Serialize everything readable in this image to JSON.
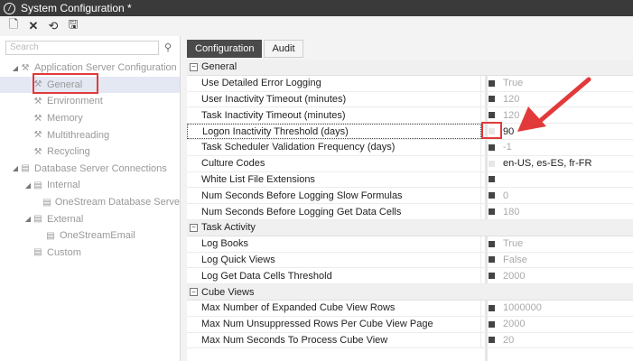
{
  "window": {
    "title": "System Configuration *"
  },
  "toolbar": {
    "buttons": [
      {
        "name": "new-button",
        "icon": "new-document-icon"
      },
      {
        "name": "delete-button",
        "icon": "close-icon"
      },
      {
        "name": "refresh-button",
        "icon": "refresh-icon"
      },
      {
        "name": "save-button",
        "icon": "save-icon"
      }
    ]
  },
  "search": {
    "placeholder": "Search"
  },
  "tree": [
    {
      "label": "Application Server Configuration",
      "depth": 0,
      "twisty": "◢",
      "icon": "wrench-icon"
    },
    {
      "label": "General",
      "depth": 1,
      "twisty": "",
      "icon": "wrench-icon",
      "selected": true
    },
    {
      "label": "Environment",
      "depth": 1,
      "twisty": "",
      "icon": "wrench-icon"
    },
    {
      "label": "Memory",
      "depth": 1,
      "twisty": "",
      "icon": "wrench-icon"
    },
    {
      "label": "Multithreading",
      "depth": 1,
      "twisty": "",
      "icon": "wrench-icon"
    },
    {
      "label": "Recycling",
      "depth": 1,
      "twisty": "",
      "icon": "wrench-icon"
    },
    {
      "label": "Database Server Connections",
      "depth": 0,
      "twisty": "◢",
      "icon": "database-icon"
    },
    {
      "label": "Internal",
      "depth": 1,
      "twisty": "◢",
      "icon": "database-icon"
    },
    {
      "label": "OneStream Database Serve",
      "depth": 2,
      "twisty": "",
      "icon": "database-icon"
    },
    {
      "label": "External",
      "depth": 1,
      "twisty": "◢",
      "icon": "database-icon"
    },
    {
      "label": "OneStreamEmail",
      "depth": 2,
      "twisty": "",
      "icon": "database-icon"
    },
    {
      "label": "Custom",
      "depth": 1,
      "twisty": "",
      "icon": "database-icon"
    }
  ],
  "tabs": [
    {
      "label": "Configuration",
      "active": true
    },
    {
      "label": "Audit",
      "active": false
    }
  ],
  "grid": [
    {
      "type": "category",
      "label": "General",
      "toggle": "⊟"
    },
    {
      "type": "prop",
      "name": "Use Detailed Error Logging",
      "value": "True",
      "check": "on"
    },
    {
      "type": "prop",
      "name": "User Inactivity Timeout (minutes)",
      "value": "120",
      "check": "on"
    },
    {
      "type": "prop",
      "name": "Task Inactivity Timeout (minutes)",
      "value": "120",
      "check": "on"
    },
    {
      "type": "prop",
      "name": "Logon Inactivity Threshold (days)",
      "value": "90",
      "check": "off",
      "focused": true,
      "dark": true
    },
    {
      "type": "prop",
      "name": "Task Scheduler Validation Frequency (days)",
      "value": "-1",
      "check": "on"
    },
    {
      "type": "prop",
      "name": "Culture Codes",
      "value": "en-US, es-ES, fr-FR",
      "check": "off",
      "dark": true
    },
    {
      "type": "prop",
      "name": "White List File Extensions",
      "value": "",
      "check": "on"
    },
    {
      "type": "prop",
      "name": "Num Seconds Before Logging Slow Formulas",
      "value": "0",
      "check": "on"
    },
    {
      "type": "prop",
      "name": "Num Seconds Before Logging Get Data Cells",
      "value": "180",
      "check": "on"
    },
    {
      "type": "category",
      "label": "Task Activity",
      "toggle": "⊟"
    },
    {
      "type": "prop",
      "name": "Log Books",
      "value": "True",
      "check": "on"
    },
    {
      "type": "prop",
      "name": "Log Quick Views",
      "value": "False",
      "check": "on"
    },
    {
      "type": "prop",
      "name": "Log Get Data Cells Threshold",
      "value": "2000",
      "check": "on"
    },
    {
      "type": "category",
      "label": "Cube Views",
      "toggle": "⊟"
    },
    {
      "type": "prop",
      "name": "Max Number of Expanded Cube View Rows",
      "value": "1000000",
      "check": "on"
    },
    {
      "type": "prop",
      "name": "Max Num Unsuppressed Rows Per Cube View Page",
      "value": "2000",
      "check": "on"
    },
    {
      "type": "prop",
      "name": "Max Num Seconds To Process Cube View",
      "value": "20",
      "check": "on"
    }
  ],
  "colors": {
    "annotation": "#e23a3a",
    "titlebar": "#3a3a3a",
    "activeTab": "#4a4a4a"
  }
}
